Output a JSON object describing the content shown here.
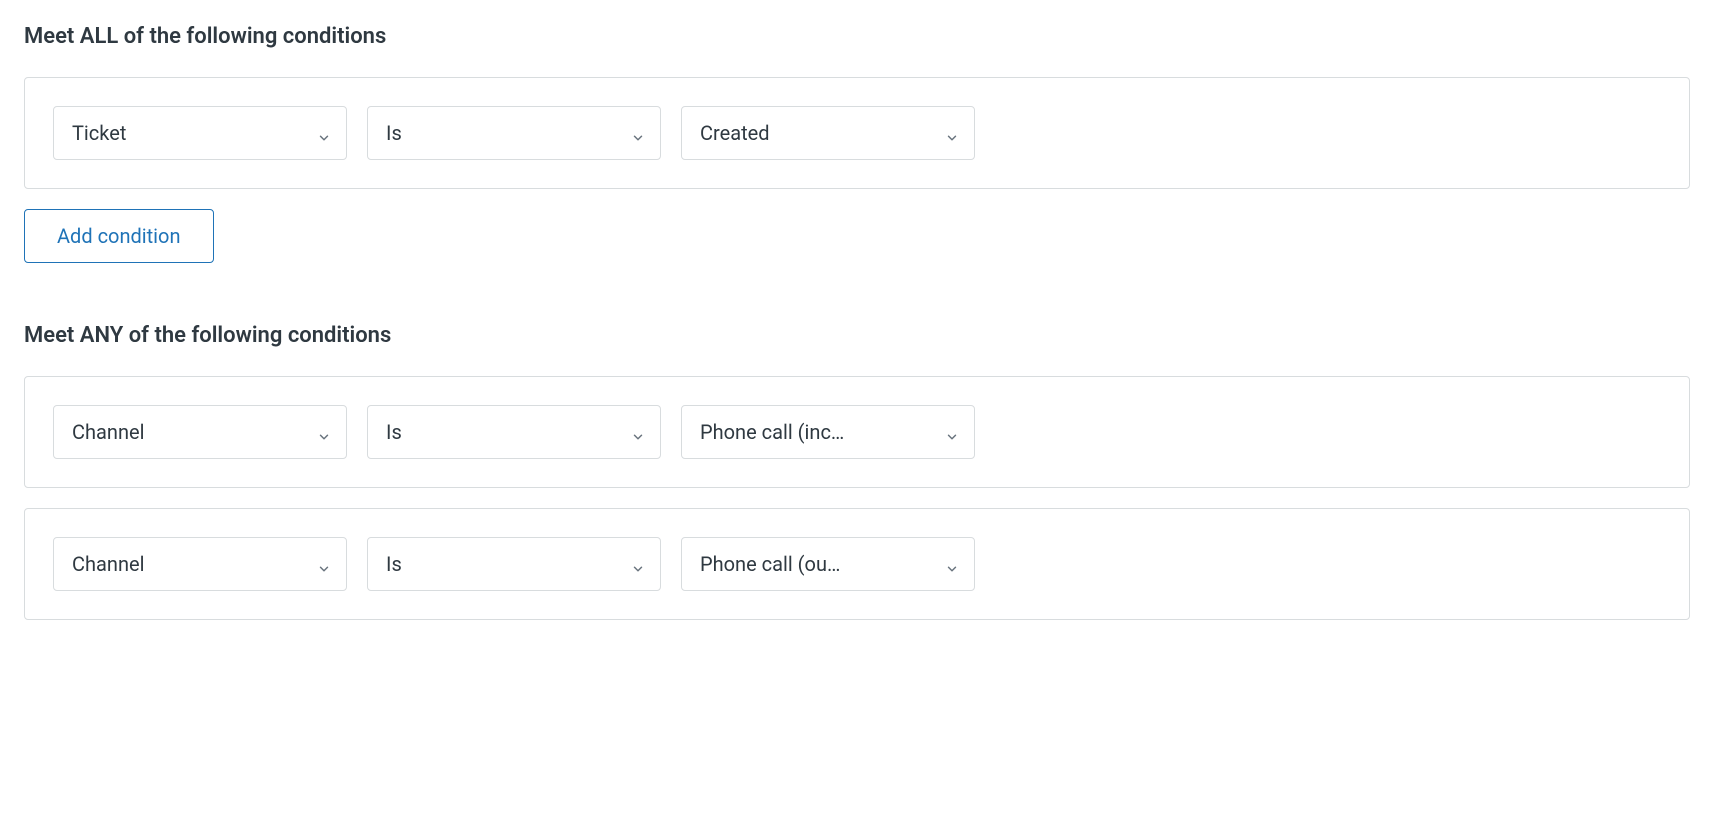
{
  "all": {
    "title": "Meet ALL of the following conditions",
    "conditions": [
      {
        "field": "Ticket",
        "operator": "Is",
        "value": "Created"
      }
    ],
    "add_label": "Add condition"
  },
  "any": {
    "title": "Meet ANY of the following conditions",
    "conditions": [
      {
        "field": "Channel",
        "operator": "Is",
        "value": "Phone call (inc…"
      },
      {
        "field": "Channel",
        "operator": "Is",
        "value": "Phone call (ou…"
      }
    ]
  }
}
